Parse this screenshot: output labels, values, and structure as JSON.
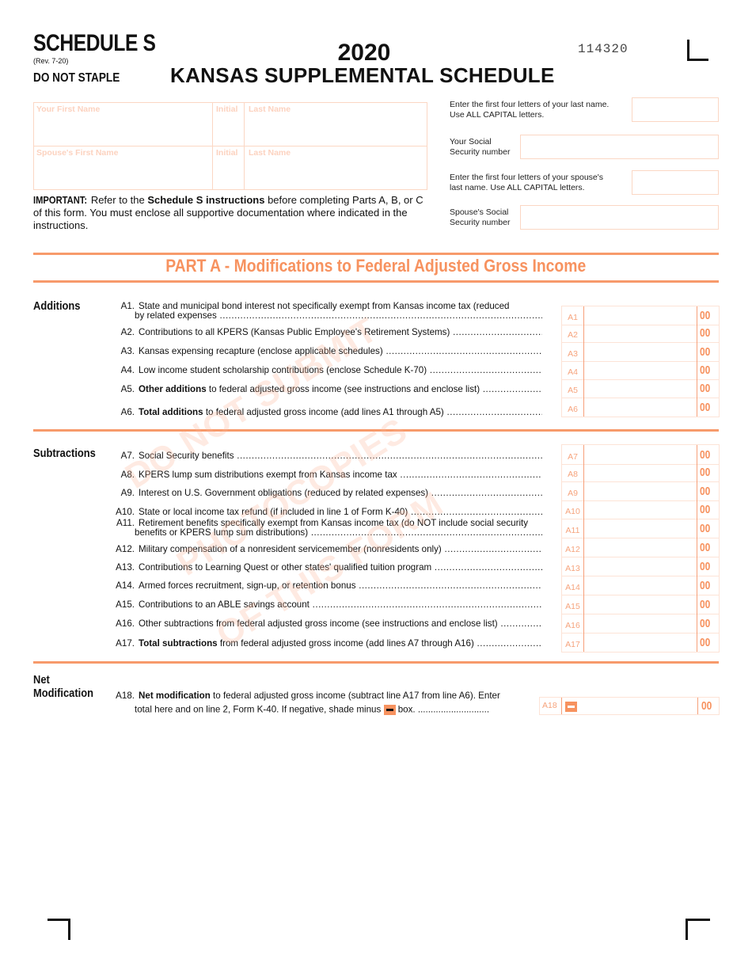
{
  "header": {
    "schedule": "SCHEDULE S",
    "revision": "(Rev. 7-20)",
    "do_not_staple": "DO NOT STAPLE",
    "year": "2020",
    "title": "KANSAS SUPPLEMENTAL SCHEDULE",
    "form_number": "114320"
  },
  "names": {
    "your_first_name": "Your First Name",
    "initial": "Initial",
    "last_name": "Last Name",
    "spouse_first_name": "Spouse's First Name",
    "spouse_initial": "Initial",
    "spouse_last_name": "Last Name",
    "your_first_value": "",
    "your_initial_value": "",
    "your_last_value": "",
    "spouse_first_value": "",
    "spouse_initial_value": "",
    "spouse_last_value": ""
  },
  "important": {
    "lead": "IMPORTANT:",
    "t1": " Refer to the ",
    "bold": "Schedule S instructions",
    "t2": " before completing Parts A, B, or C of this form. You must enclose all supportive documentation where indicated in the instructions."
  },
  "right_fields": {
    "last4_label_1": "Enter the first four letters of your last name.",
    "last4_label_2": "Use ALL CAPITAL letters.",
    "ssn_label_1": "Your Social",
    "ssn_label_2": "Security number",
    "spouse_last4_label_1": "Enter the first four letters of your spouse's",
    "spouse_last4_label_2": "last name. Use ALL CAPITAL letters.",
    "spouse_ssn_label_1": "Spouse's Social",
    "spouse_ssn_label_2": "Security number",
    "last4_value": "",
    "ssn_value": "",
    "spouse_last4_value": "",
    "spouse_ssn_value": ""
  },
  "part_a": {
    "title": "PART A - Modifications to Federal Adjusted Gross Income",
    "additions_label": "Additions",
    "subtractions_label": "Subtractions",
    "net_label_1": "Net",
    "net_label_2": "Modification",
    "cents": "00",
    "lines": [
      {
        "num": "A1.",
        "bold": "",
        "text": "State and municipal bond interest not specifically exempt from Kansas income tax (reduced",
        "text2": "by related expenses",
        "box": "A1",
        "value": ""
      },
      {
        "num": "A2.",
        "bold": "",
        "text": "Contributions to all KPERS (Kansas Public Employee's Retirement Systems)",
        "text2": "",
        "box": "A2",
        "value": ""
      },
      {
        "num": "A3.",
        "bold": "",
        "text": "Kansas expensing recapture (enclose applicable schedules)",
        "text2": "",
        "box": "A3",
        "value": ""
      },
      {
        "num": "A4.",
        "bold": "",
        "text": "Low income student scholarship contributions (enclose Schedule K-70)",
        "text2": "",
        "box": "A4",
        "value": ""
      },
      {
        "num": "A5.",
        "bold": "Other additions",
        "text": " to federal adjusted gross income (see instructions and enclose list)",
        "text2": "",
        "box": "A5",
        "value": ""
      },
      {
        "num": "A6.",
        "bold": "Total additions",
        "text": " to federal adjusted gross income (add lines A1 through A5)",
        "text2": "",
        "box": "A6",
        "value": ""
      },
      {
        "num": "A7.",
        "bold": "",
        "text": "Social Security benefits",
        "text2": "",
        "box": "A7",
        "value": ""
      },
      {
        "num": "A8.",
        "bold": "",
        "text": "KPERS lump sum distributions exempt from Kansas income tax",
        "text2": "",
        "box": "A8",
        "value": ""
      },
      {
        "num": "A9.",
        "bold": "",
        "text": "Interest on U.S. Government obligations (reduced by related expenses)",
        "text2": "",
        "box": "A9",
        "value": ""
      },
      {
        "num": "A10.",
        "bold": "",
        "text": "State or local income tax refund (if included in line 1 of Form K-40)",
        "text2": "",
        "box": "A10",
        "value": ""
      },
      {
        "num": "A11.",
        "bold": "",
        "text": "Retirement benefits specifically exempt from Kansas income tax (do NOT include social security",
        "text2": "benefits or KPERS lump sum distributions)",
        "box": "A11",
        "value": ""
      },
      {
        "num": "A12.",
        "bold": "",
        "text": "Military compensation of a nonresident servicemember (nonresidents only)",
        "text2": "",
        "box": "A12",
        "value": ""
      },
      {
        "num": "A13.",
        "bold": "",
        "text": "Contributions to Learning Quest or other states' qualified tuition program",
        "text2": "",
        "box": "A13",
        "value": ""
      },
      {
        "num": "A14.",
        "bold": "",
        "text": "Armed forces recruitment, sign-up, or retention bonus",
        "text2": "",
        "box": "A14",
        "value": ""
      },
      {
        "num": "A15.",
        "bold": "",
        "text": "Contributions to an ABLE savings account",
        "text2": "",
        "box": "A15",
        "value": ""
      },
      {
        "num": "A16.",
        "bold": "",
        "text": "Other subtractions from federal adjusted gross income (see instructions and enclose list)",
        "text2": "",
        "box": "A16",
        "value": ""
      },
      {
        "num": "A17.",
        "bold": "Total subtractions",
        "text": " from federal adjusted gross income (add lines A7 through A16)",
        "text2": "",
        "box": "A17",
        "value": ""
      }
    ],
    "a18": {
      "num": "A18.",
      "bold": "Net modification",
      "text": " to federal adjusted gross income (subtract line A17 from line A6). Enter",
      "text2a": "total here and on line 2, Form K-40. If negative, shade minus ",
      "text2b": " box.",
      "box": "A18",
      "value": "",
      "negative_shaded": false
    }
  },
  "watermark": {
    "line1": "DO NOT SUBMIT",
    "line2": "PHOTOCOPIES",
    "line3": "OF THIS FORM"
  },
  "colors": {
    "accent": "#f7925f",
    "box_border": "#fbd7c4"
  }
}
